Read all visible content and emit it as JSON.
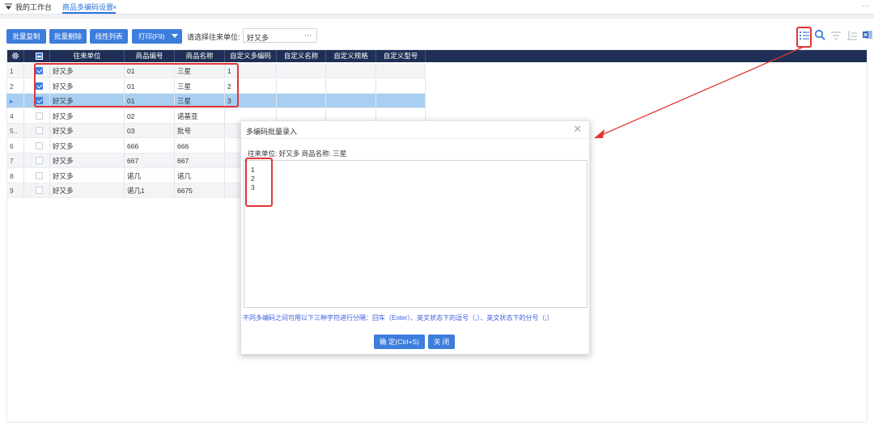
{
  "tabs": {
    "workbench_label": "我的工作台",
    "active_label": "商品多编码设置",
    "close_glyph": "×",
    "more_glyph": "···"
  },
  "toolbar": {
    "batch_copy": "批量复制",
    "batch_delete": "批量删除",
    "linear_list": "线性列表",
    "print": "打印(F9)",
    "select_label": "请选择往来单位:",
    "select_value": "好又多",
    "select_dots": "···"
  },
  "grid": {
    "columns": [
      "往来单位",
      "商品编号",
      "商品名称",
      "自定义多编码",
      "自定义名称",
      "自定义规格",
      "自定义型号"
    ],
    "rows": [
      {
        "rn": "1",
        "checked": true,
        "unit": "好又多",
        "code": "01",
        "name": "三星",
        "multi": "1"
      },
      {
        "rn": "2",
        "checked": true,
        "unit": "好又多",
        "code": "01",
        "name": "三星",
        "multi": "2"
      },
      {
        "rn": "▸",
        "checked": true,
        "unit": "好又多",
        "code": "01",
        "name": "三星",
        "multi": "3"
      },
      {
        "rn": "4",
        "checked": false,
        "unit": "好又多",
        "code": "02",
        "name": "诺基亚",
        "multi": ""
      },
      {
        "rn": "5..",
        "checked": false,
        "unit": "好又多",
        "code": "03",
        "name": "批号",
        "multi": ""
      },
      {
        "rn": "6",
        "checked": false,
        "unit": "好又多",
        "code": "666",
        "name": "666",
        "multi": ""
      },
      {
        "rn": "7",
        "checked": false,
        "unit": "好又多",
        "code": "667",
        "name": "667",
        "multi": ""
      },
      {
        "rn": "8",
        "checked": false,
        "unit": "好又多",
        "code": "诺几",
        "name": "诺几",
        "multi": ""
      },
      {
        "rn": "9",
        "checked": false,
        "unit": "好又多",
        "code": "诺几1",
        "name": "6675",
        "multi": ""
      }
    ]
  },
  "dialog": {
    "title": "多编码批量录入",
    "close_glyph": "✕",
    "info": "往来单位: 好又多   商品名称: 三星",
    "lines": [
      "1",
      "2",
      "3"
    ],
    "hint": "不同多编码之间可用以下三种字符进行分隔：回车（Enter）、英文状态下的逗号（,）、英文状态下的分号（;）",
    "confirm": "确 定(Ctrl+S)",
    "close": "关 闭"
  },
  "colors": {
    "accent": "#3d7ddc",
    "header_bg": "#1f2f55",
    "selected_row": "#a8cef2",
    "annotation_red": "#e03535"
  }
}
